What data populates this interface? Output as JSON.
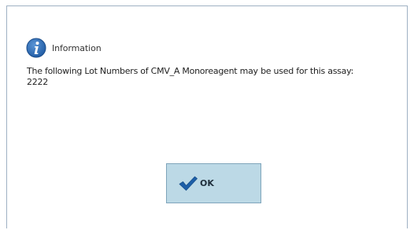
{
  "dialog": {
    "header_label": "Information",
    "message_line1": "The following Lot Numbers of CMV_A Monoreagent may be used for this assay:",
    "message_line2": "2222",
    "ok_label": "OK"
  },
  "icons": {
    "header": "information-icon",
    "ok": "checkmark-icon"
  },
  "colors": {
    "info_icon": "#2b6ab3",
    "checkmark": "#1d5fa8",
    "ok_button_bg": "#bcd9e6",
    "dialog_border": "#9fb1c3"
  }
}
